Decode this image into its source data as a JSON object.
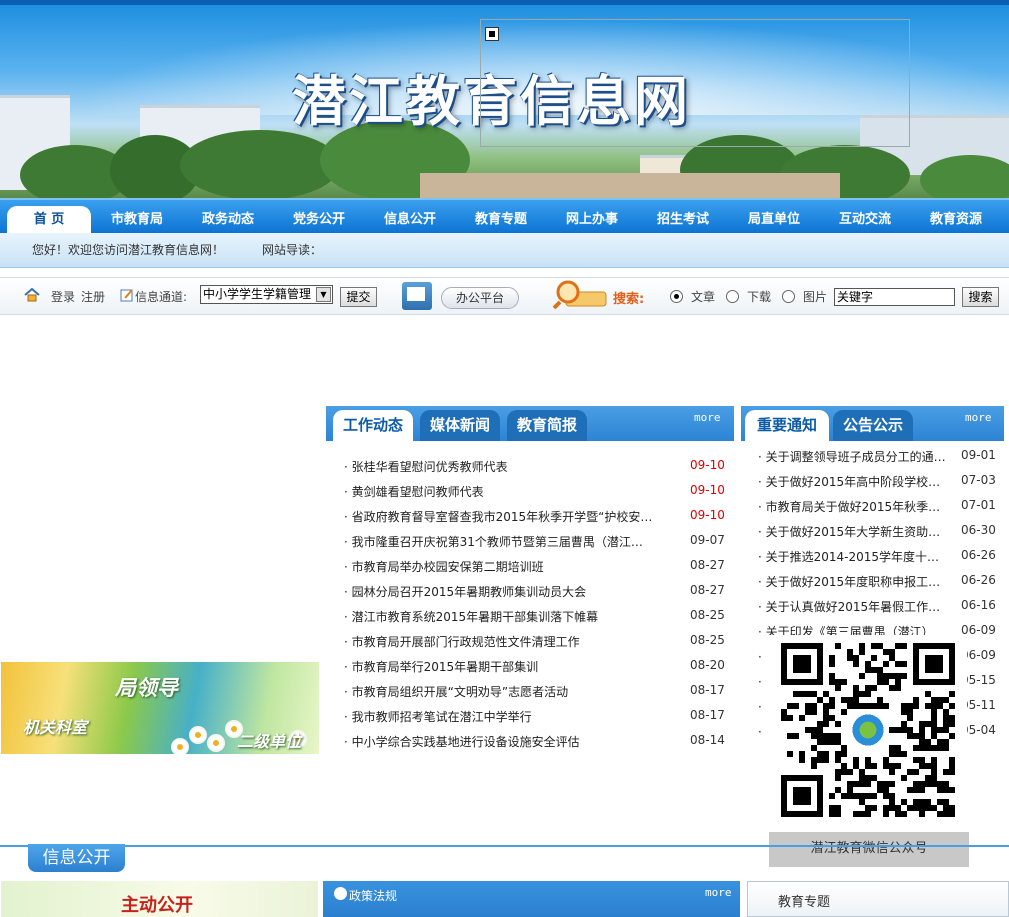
{
  "site": {
    "title": "潜江教育信息网"
  },
  "nav": {
    "items": [
      "首 页",
      "市教育局",
      "政务动态",
      "党务公开",
      "信息公开",
      "教育专题",
      "网上办事",
      "招生考试",
      "局直单位",
      "互动交流",
      "教育资源"
    ]
  },
  "subnav": {
    "welcome": "您好！欢迎您访问潜江教育信息网！",
    "guide_label": "网站导读："
  },
  "toolbar": {
    "login": "登录",
    "register": "注册",
    "channel_label": "信息通道:",
    "channel_selected": "中小学学生学籍管理",
    "submit": "提交",
    "office": "办公平台",
    "search_label": "搜索:",
    "search_options": [
      "文章",
      "下载",
      "图片"
    ],
    "search_selected": "文章",
    "keyword_value": "关键字",
    "search_button": "搜索"
  },
  "news_panel": {
    "tabs": [
      "工作动态",
      "媒体新闻",
      "教育简报"
    ],
    "more": "more",
    "items": [
      {
        "title": "张桂华看望慰问优秀教师代表",
        "date": "09-10",
        "highlight": true
      },
      {
        "title": "黄剑雄看望慰问教师代表",
        "date": "09-10",
        "highlight": true
      },
      {
        "title": "省政府教育督导室督查我市2015年秋季开学暨“护校安…",
        "date": "09-10",
        "highlight": true
      },
      {
        "title": "我市隆重召开庆祝第31个教师节暨第三届曹禺（潜江）…",
        "date": "09-07",
        "highlight": false
      },
      {
        "title": "市教育局举办校园安保第二期培训班",
        "date": "08-27",
        "highlight": false
      },
      {
        "title": "园林分局召开2015年暑期教师集训动员大会",
        "date": "08-27",
        "highlight": false
      },
      {
        "title": "潜江市教育系统2015年暑期干部集训落下帷幕",
        "date": "08-25",
        "highlight": false
      },
      {
        "title": "市教育局开展部门行政规范性文件清理工作",
        "date": "08-25",
        "highlight": false
      },
      {
        "title": "市教育局举行2015年暑期干部集训",
        "date": "08-20",
        "highlight": false
      },
      {
        "title": "市教育局组织开展“文明劝导”志愿者活动",
        "date": "08-17",
        "highlight": false
      },
      {
        "title": "我市教师招考笔试在潜江中学举行",
        "date": "08-17",
        "highlight": false
      },
      {
        "title": "中小学综合实践基地进行设备设施安全评估",
        "date": "08-14",
        "highlight": false
      }
    ]
  },
  "notice_panel": {
    "tabs": [
      "重要通知",
      "公告公示"
    ],
    "more": "more",
    "items": [
      {
        "title": "关于调整领导班子成员分工的通…",
        "date": "09-01"
      },
      {
        "title": "关于做好2015年高中阶段学校招…",
        "date": "07-03"
      },
      {
        "title": "市教育局关于做好2015年秋季义…",
        "date": "07-01"
      },
      {
        "title": "关于做好2015年大学新生资助项…",
        "date": "06-30"
      },
      {
        "title": "关于推选2014-2015学年度十佳…",
        "date": "06-26"
      },
      {
        "title": "关于做好2015年度职称申报工作…",
        "date": "06-26"
      },
      {
        "title": "关于认真做好2015年暑假工作的…",
        "date": "06-16"
      },
      {
        "title": "关于印发《第三届曹禺（潜江）",
        "date": "06-09"
      },
      {
        "title": "关",
        "date": "06-09"
      },
      {
        "title": "关",
        "date": "05-15"
      },
      {
        "title": "关",
        "date": "05-11"
      },
      {
        "title": "关",
        "date": "05-04"
      }
    ]
  },
  "leader_banner": {
    "main": "局领导",
    "left": "机关科室",
    "right": "二级单位"
  },
  "qr": {
    "caption": "潜江教育微信公众号"
  },
  "info_section": {
    "title": "信息公开",
    "active_public": "主动公开",
    "policy": "政策法规",
    "policy_more": "more",
    "edu_topic": "教育专题"
  }
}
